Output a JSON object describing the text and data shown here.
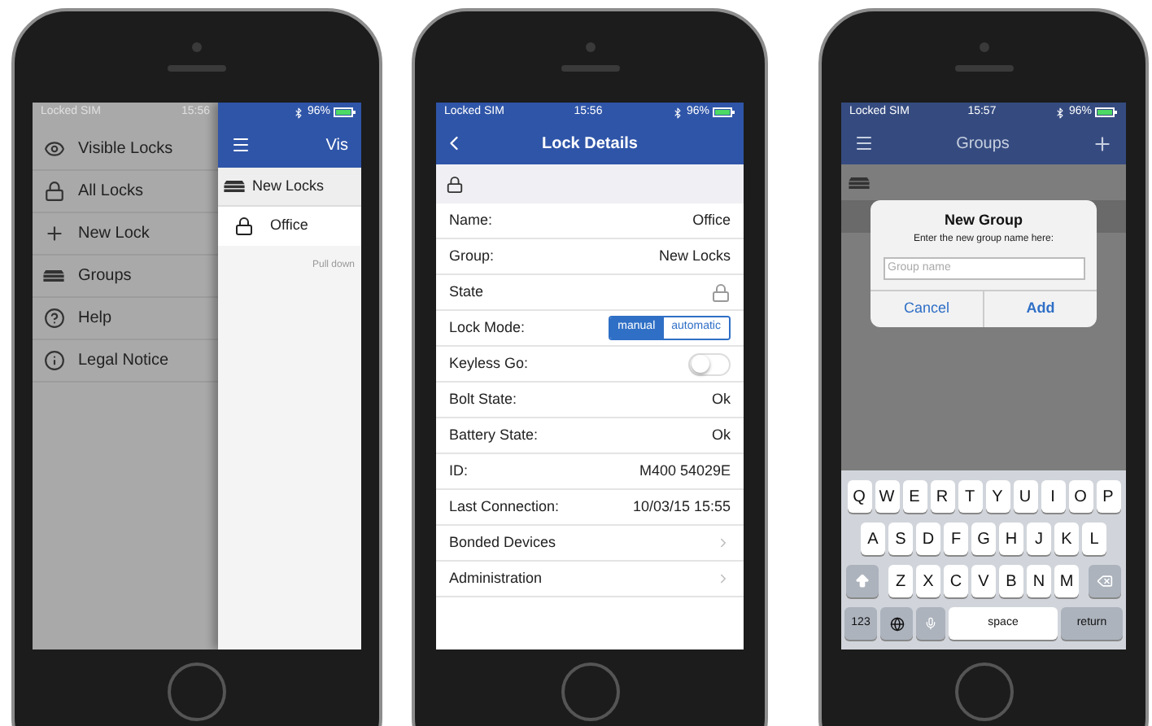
{
  "menu_screen": {
    "status_bar": {
      "carrier": "Locked SIM",
      "time": "15:56",
      "battery": "96%"
    },
    "menu_items": [
      {
        "label": "Visible Locks"
      },
      {
        "label": "All Locks"
      },
      {
        "label": "New Lock"
      },
      {
        "label": "Groups"
      },
      {
        "label": "Help"
      },
      {
        "label": "Legal Notice"
      }
    ],
    "header": {
      "title": "Vis"
    },
    "list": {
      "group": "New Locks",
      "items": [
        {
          "label": "Office"
        }
      ],
      "hint": "Pull down"
    }
  },
  "details_screen": {
    "status_bar": {
      "carrier": "Locked SIM",
      "time": "15:56",
      "battery": "96%"
    },
    "header": {
      "title": "Lock Details"
    },
    "rows": [
      {
        "kind": "value",
        "label": "Name:",
        "value": "Office"
      },
      {
        "kind": "value",
        "label": "Group:",
        "value": "New Locks"
      },
      {
        "kind": "state",
        "label": "State"
      },
      {
        "kind": "segmented",
        "label": "Lock Mode:",
        "options": [
          {
            "label": "manual",
            "selected": true
          },
          {
            "label": "automatic",
            "selected": false
          }
        ]
      },
      {
        "kind": "toggle",
        "label": "Keyless Go:",
        "on": false
      },
      {
        "kind": "value",
        "label": "Bolt State:",
        "value": "Ok"
      },
      {
        "kind": "value",
        "label": "Battery State:",
        "value": "Ok"
      },
      {
        "kind": "value",
        "label": "ID:",
        "value": "M400 54029E"
      },
      {
        "kind": "value",
        "label": "Last Connection:",
        "value": "10/03/15 15:55"
      },
      {
        "kind": "link",
        "label": "Bonded Devices"
      },
      {
        "kind": "link",
        "label": "Administration"
      }
    ]
  },
  "groups_screen": {
    "status_bar": {
      "carrier": "Locked SIM",
      "time": "15:57",
      "battery": "96%"
    },
    "header": {
      "title": "Groups"
    },
    "dialog": {
      "title": "New Group",
      "message": "Enter the new group name here:",
      "placeholder": "Group name",
      "buttons": [
        "Cancel",
        "Add"
      ]
    },
    "keyboard": {
      "letter_rows": [
        [
          "Q",
          "W",
          "E",
          "R",
          "T",
          "Y",
          "U",
          "I",
          "O",
          "P"
        ],
        [
          "A",
          "S",
          "D",
          "F",
          "G",
          "H",
          "J",
          "K",
          "L"
        ],
        [
          "Z",
          "X",
          "C",
          "V",
          "B",
          "N",
          "M"
        ]
      ],
      "bottom_row": {
        "numbers_key": "123",
        "space_key": "space",
        "return_key": "return"
      }
    }
  }
}
